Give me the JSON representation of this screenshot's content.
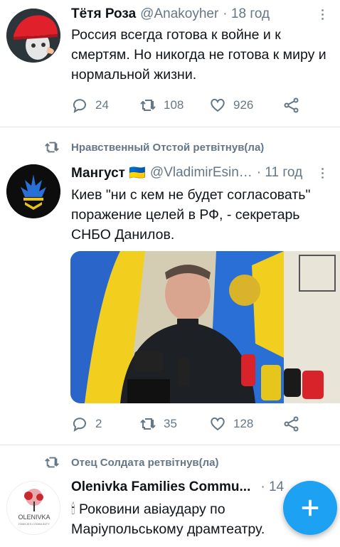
{
  "tweets": [
    {
      "name": "Тётя Роза",
      "handle": "@Anakoyher",
      "time": "· 18 год",
      "text": "Россия всегда готова к войне и к смертям. Но никогда не готова к миру и нормальной жизни.",
      "replies": "24",
      "retweets": "108",
      "likes": "926"
    },
    {
      "retweeted_by": "Нравственный Отстой ретвітнув(ла)",
      "name": "Мангуст 🇺🇦",
      "handle": "@VladimirEsin…",
      "time": "· 11 год",
      "text": "Киев \"ни с кем не будет согласовать\" поражение целей в РФ, - секретарь СНБО Данилов.",
      "replies": "2",
      "retweets": "35",
      "likes": "128"
    },
    {
      "retweeted_by": "Отец Солдата ретвітнув(ла)",
      "name": "Olenivka Families Commu...",
      "time": "· 14",
      "text": "🕯 Роковини авіаудару по Маріупольському драмтеатру.",
      "avatar_label": "OLENIVKA",
      "avatar_sublabel": "FAMILIES COMMUNITY"
    }
  ],
  "colors": {
    "accent": "#1da1f2",
    "muted": "#657786"
  }
}
